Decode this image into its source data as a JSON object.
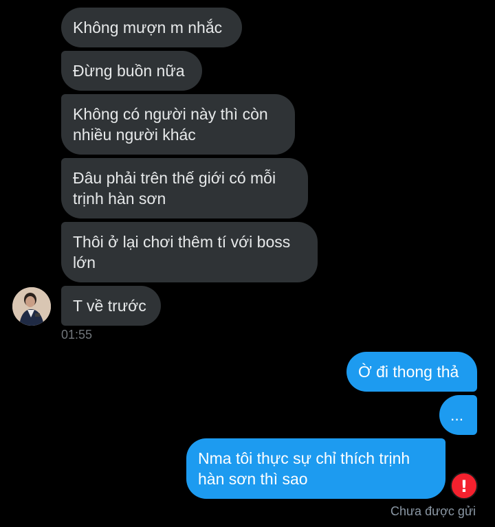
{
  "conversation": {
    "incoming": [
      {
        "lines": [
          "Không mượn m nhắc"
        ]
      },
      {
        "lines": [
          "Đừng buồn nữa"
        ]
      },
      {
        "lines": [
          "Không có người này thì còn",
          "nhiều người khác"
        ]
      },
      {
        "lines": [
          "Đâu phải trên thế giới có mỗi",
          "trịnh hàn sơn"
        ]
      },
      {
        "lines": [
          "Thôi ở lại chơi thêm tí với boss",
          "lớn"
        ]
      },
      {
        "lines": [
          "T về trước"
        ]
      }
    ],
    "incoming_timestamp": "01:55",
    "outgoing": [
      {
        "lines": [
          "Ờ đi thong thả"
        ]
      },
      {
        "lines": [
          "..."
        ]
      },
      {
        "lines": [
          "Nma tôi thực sự chỉ thích trịnh",
          "hàn sơn thì sao"
        ]
      }
    ],
    "send_error_icon": "exclamation-icon",
    "send_error_text": "Chưa được gửi"
  },
  "colors": {
    "background": "#000000",
    "incoming_bubble": "#2f3336",
    "outgoing_bubble": "#1d9bf0",
    "error": "#f4212e",
    "meta_text": "#71767b"
  }
}
